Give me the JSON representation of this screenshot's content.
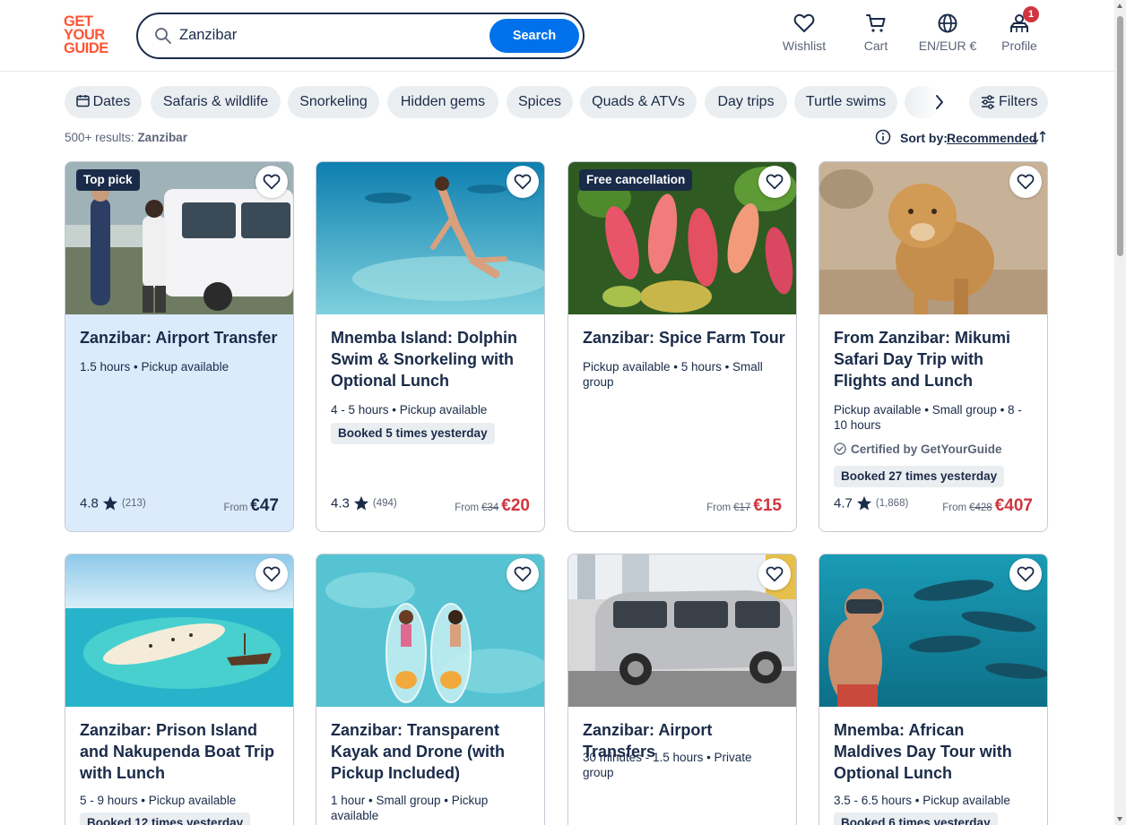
{
  "header": {
    "logo": [
      "GET",
      "YOUR",
      "GUIDE"
    ],
    "search_value": "Zanzibar",
    "search_button": "Search",
    "nav": {
      "wishlist": "Wishlist",
      "cart": "Cart",
      "language": "EN/EUR €",
      "profile": "Profile",
      "profile_badge": "1"
    }
  },
  "chips": [
    "Dates",
    "Safaris & wildlife",
    "Snorkeling",
    "Hidden gems",
    "Spices",
    "Quads & ATVs",
    "Day trips",
    "Turtle swims"
  ],
  "filters_label": "Filters",
  "results": {
    "count": "500+ results:",
    "query": "Zanzibar"
  },
  "sort": {
    "label": "Sort by:",
    "value": "Recommended"
  },
  "cards": [
    {
      "tag": "Top pick",
      "title": "Zanzibar: Airport Transfer",
      "meta": "1.5 hours • Pickup available",
      "rating": "4.8",
      "reviews": "(213)",
      "from": "From",
      "price": "€47"
    },
    {
      "title": "Mnemba Island: Dolphin Swim & Snorkeling with Optional Lunch",
      "meta": "4 - 5 hours • Pickup available",
      "booked": "Booked 5 times yesterday",
      "rating": "4.3",
      "reviews": "(494)",
      "from": "From",
      "old_price": "€34",
      "price": "€20"
    },
    {
      "tag": "Free cancellation",
      "title": "Zanzibar: Spice Farm Tour",
      "meta": "Pickup available • 5 hours • Small group",
      "from": "From",
      "old_price": "€17",
      "price": "€15"
    },
    {
      "title": "From Zanzibar: Mikumi Safari Day Trip with Flights and Lunch",
      "meta": "Pickup available • Small group • 8 - 10 hours",
      "certified": "Certified by GetYourGuide",
      "booked": "Booked 27 times yesterday",
      "rating": "4.7",
      "reviews": "(1,868)",
      "from": "From",
      "old_price": "€428",
      "price": "€407"
    },
    {
      "title": "Zanzibar: Prison Island and Nakupenda Boat Trip with Lunch",
      "meta": "5 - 9 hours • Pickup available",
      "booked": "Booked 12 times yesterday"
    },
    {
      "title": "Zanzibar: Transparent Kayak and Drone (with Pickup Included)",
      "meta": "1 hour • Small group • Pickup available"
    },
    {
      "title": "Zanzibar: Airport Transfers",
      "meta": "30 minutes - 1.5 hours • Private group"
    },
    {
      "title": "Mnemba: African Maldives Day Tour with Optional Lunch",
      "meta": "3.5 - 6.5 hours • Pickup available",
      "booked": "Booked 6 times yesterday"
    }
  ],
  "colors": {
    "brand": "#ff5533",
    "primary_button": "#0071eb",
    "text": "#1a2b49",
    "sale_price": "#d0353f",
    "highlight_card": "#dcebfc"
  }
}
